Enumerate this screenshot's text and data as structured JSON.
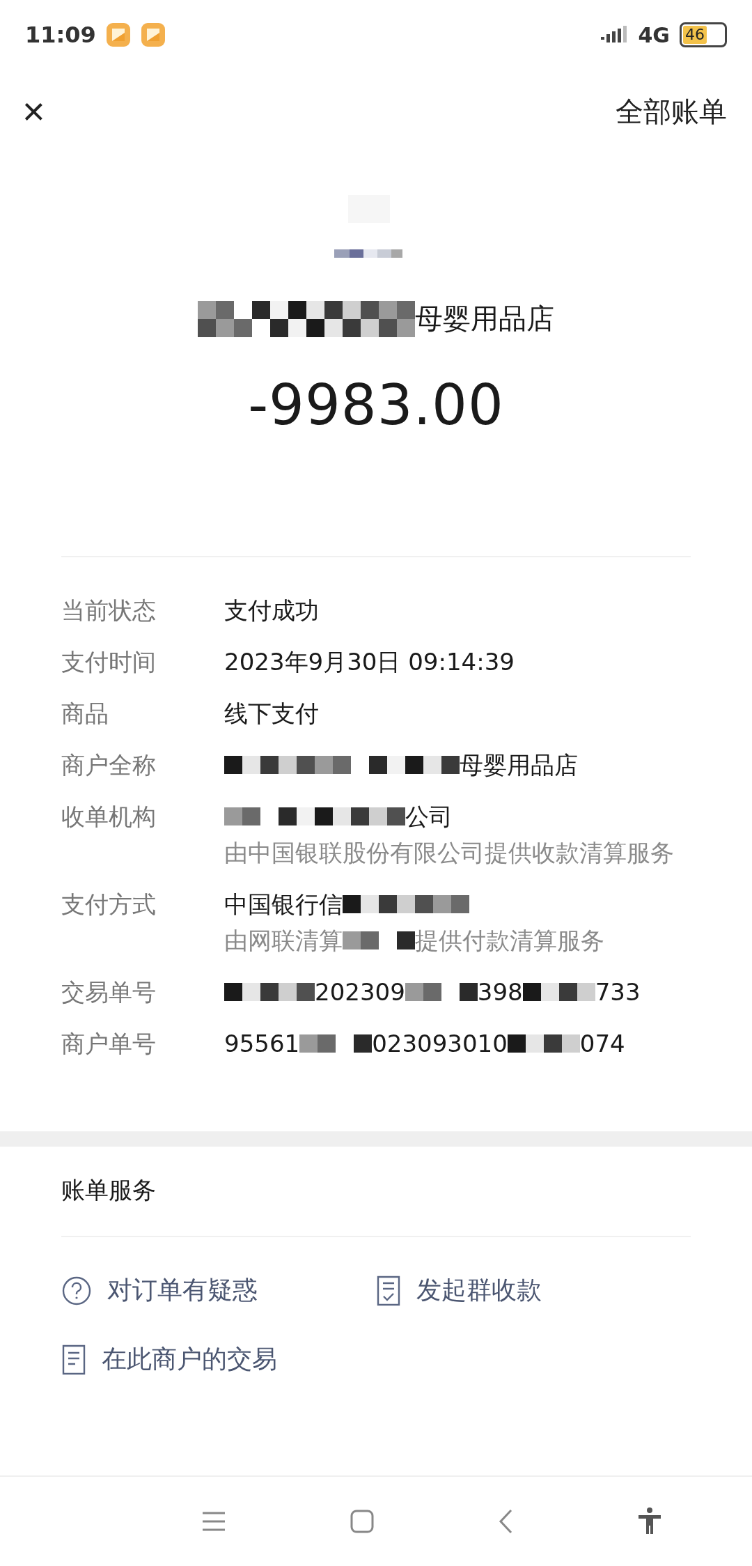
{
  "status_bar": {
    "time": "11:09",
    "network": "4G",
    "battery": "46"
  },
  "header": {
    "close": "×",
    "title": "全部账单"
  },
  "summary": {
    "merchant": [
      {
        "kind": "redacted"
      },
      {
        "kind": "text",
        "text": "母婴用品店"
      }
    ],
    "amount": "-9983.00"
  },
  "details": [
    {
      "label": "当前状态",
      "value": [
        {
          "kind": "text",
          "text": "支付成功"
        }
      ]
    },
    {
      "label": "支付时间",
      "value": [
        {
          "kind": "text",
          "text": "2023年9月30日 09:14:39"
        }
      ]
    },
    {
      "label": "商品",
      "value": [
        {
          "kind": "text",
          "text": "线下支付"
        }
      ]
    },
    {
      "label": "商户全称",
      "value": [
        {
          "kind": "redacted"
        },
        {
          "kind": "text",
          "text": "母婴用品店"
        }
      ]
    },
    {
      "label": "收单机构",
      "value": [
        {
          "kind": "redacted"
        },
        {
          "kind": "text",
          "text": "公司"
        }
      ],
      "note": [
        {
          "kind": "text",
          "text": "由中国银联股份有限公司提供收款清算服务"
        }
      ]
    },
    {
      "label": "支付方式",
      "value": [
        {
          "kind": "text",
          "text": "中国银行信"
        },
        {
          "kind": "redacted"
        }
      ],
      "note": [
        {
          "kind": "text",
          "text": "由网联清算"
        },
        {
          "kind": "redacted"
        },
        {
          "kind": "text",
          "text": "提供付款清算服务"
        }
      ]
    },
    {
      "label": "交易单号",
      "value": [
        {
          "kind": "redacted"
        },
        {
          "kind": "text",
          "text": "202309"
        },
        {
          "kind": "redacted"
        },
        {
          "kind": "text",
          "text": "398"
        },
        {
          "kind": "redacted"
        },
        {
          "kind": "text",
          "text": "733"
        }
      ]
    },
    {
      "label": "商户单号",
      "value": [
        {
          "kind": "text",
          "text": "95561"
        },
        {
          "kind": "redacted"
        },
        {
          "kind": "text",
          "text": "023093010"
        },
        {
          "kind": "redacted"
        },
        {
          "kind": "text",
          "text": "074"
        }
      ]
    }
  ],
  "services": {
    "title": "账单服务",
    "actions": [
      {
        "kind": "question",
        "label": "对订单有疑惑"
      },
      {
        "kind": "split",
        "label": "发起群收款"
      },
      {
        "kind": "list",
        "label": "在此商户的交易"
      }
    ]
  }
}
